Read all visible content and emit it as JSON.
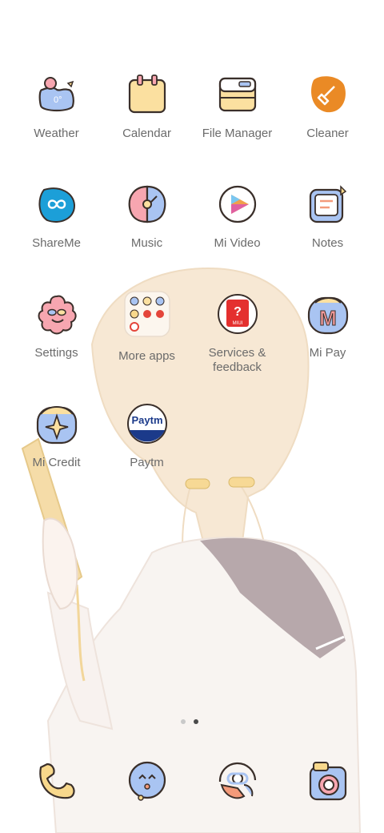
{
  "apps": [
    {
      "label": "Weather",
      "icon": "weather-icon",
      "temp": "0°"
    },
    {
      "label": "Calendar",
      "icon": "calendar-icon"
    },
    {
      "label": "File Manager",
      "icon": "file-manager-icon"
    },
    {
      "label": "Cleaner",
      "icon": "broom-icon"
    },
    {
      "label": "ShareMe",
      "icon": "shareme-infinity-icon"
    },
    {
      "label": "Music",
      "icon": "music-icon"
    },
    {
      "label": "Mi Video",
      "icon": "play-icon"
    },
    {
      "label": "Notes",
      "icon": "notes-icon"
    },
    {
      "label": "Settings",
      "icon": "flower-face-icon"
    },
    {
      "label": "More apps",
      "icon": "folder-icon"
    },
    {
      "label": "Services &\nfeedback",
      "icon": "question-icon",
      "badge": "MIUI"
    },
    {
      "label": "Mi Pay",
      "icon": "mi-pay-icon",
      "letter": "M"
    },
    {
      "label": "Mi Credit",
      "icon": "sparkle-icon"
    },
    {
      "label": "Paytm",
      "icon": "paytm-icon",
      "logo_text": "Paytm"
    }
  ],
  "dock": [
    {
      "icon": "phone-icon"
    },
    {
      "icon": "messages-icon"
    },
    {
      "icon": "browser-icon"
    },
    {
      "icon": "camera-icon"
    }
  ],
  "pager": {
    "pages": 2,
    "current": 2
  },
  "colors": {
    "label": "#6b6b6b",
    "hair": "#f6e6d0",
    "outline": "#3a2f2a",
    "collar": "#b3a4a8"
  }
}
